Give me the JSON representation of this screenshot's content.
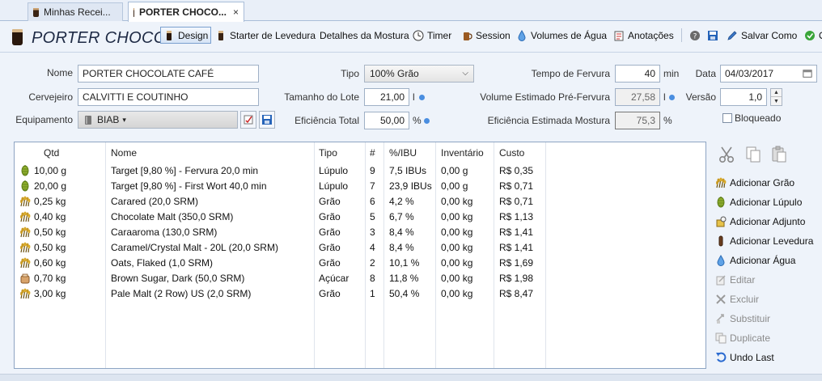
{
  "tabs": [
    {
      "label": "Minhas Recei...",
      "active": false
    },
    {
      "label": "PORTER CHOCO...",
      "active": true,
      "close": "×"
    }
  ],
  "recipe_title": "PORTER CHOCO",
  "toolbar": {
    "design": "Design",
    "starter": "Starter de Levedura",
    "detalhes": "Detalhes da Mostura",
    "timer": "Timer",
    "session": "Session",
    "volumes": "Volumes de Água",
    "anotacoes": "Anotações",
    "salvar_como": "Salvar Como",
    "ok_partial": "O"
  },
  "form": {
    "nome_label": "Nome",
    "nome": "PORTER CHOCOLATE CAFÉ",
    "cervejeiro_label": "Cervejeiro",
    "cervejeiro": "CALVITTI E COUTINHO",
    "equipamento_label": "Equipamento",
    "equipamento": "BIAB",
    "tipo_label": "Tipo",
    "tipo": "100% Grão",
    "tamanho_label": "Tamanho do Lote",
    "tamanho": "21,00",
    "tamanho_unit": "l",
    "eficiencia_label": "Eficiência Total",
    "eficiencia": "50,00",
    "eficiencia_unit": "%",
    "tempo_label": "Tempo de Fervura",
    "tempo": "40",
    "tempo_unit": "min",
    "vol_label": "Volume Estimado Pré-Fervura",
    "vol": "27,58",
    "vol_unit": "l",
    "efm_label": "Eficiência Estimada Mostura",
    "efm": "75,3",
    "efm_unit": "%",
    "data_label": "Data",
    "data": "04/03/2017",
    "versao_label": "Versão",
    "versao": "1,0",
    "bloqueado_label": "Bloqueado"
  },
  "table": {
    "headers": [
      "Qtd",
      "Nome",
      "Tipo",
      "#",
      "%/IBU",
      "Inventário",
      "Custo"
    ],
    "rows": [
      {
        "icon": "hop-icon",
        "qtd": "10,00 g",
        "nome": "Target [9,80 %] - Fervura 20,0 min",
        "tipo": "Lúpulo",
        "n": "9",
        "pct": "7,5 IBUs",
        "inv": "0,00 g",
        "custo": "R$ 0,35"
      },
      {
        "icon": "hop-icon",
        "qtd": "20,00 g",
        "nome": "Target [9,80 %] - First Wort 40,0 min",
        "tipo": "Lúpulo",
        "n": "7",
        "pct": "23,9 IBUs",
        "inv": "0,00 g",
        "custo": "R$ 0,71"
      },
      {
        "icon": "grain-icon",
        "qtd": "0,25 kg",
        "nome": "Carared (20,0 SRM)",
        "tipo": "Grão",
        "n": "6",
        "pct": "4,2 %",
        "inv": "0,00 kg",
        "custo": "R$ 0,71"
      },
      {
        "icon": "grain-icon",
        "qtd": "0,40 kg",
        "nome": "Chocolate Malt (350,0 SRM)",
        "tipo": "Grão",
        "n": "5",
        "pct": "6,7 %",
        "inv": "0,00 kg",
        "custo": "R$ 1,13"
      },
      {
        "icon": "grain-icon",
        "qtd": "0,50 kg",
        "nome": "Caraaroma (130,0 SRM)",
        "tipo": "Grão",
        "n": "3",
        "pct": "8,4 %",
        "inv": "0,00 kg",
        "custo": "R$ 1,41"
      },
      {
        "icon": "grain-icon",
        "qtd": "0,50 kg",
        "nome": "Caramel/Crystal Malt - 20L (20,0 SRM)",
        "tipo": "Grão",
        "n": "4",
        "pct": "8,4 %",
        "inv": "0,00 kg",
        "custo": "R$ 1,41"
      },
      {
        "icon": "grain-icon",
        "qtd": "0,60 kg",
        "nome": "Oats, Flaked (1,0 SRM)",
        "tipo": "Grão",
        "n": "2",
        "pct": "10,1 %",
        "inv": "0,00 kg",
        "custo": "R$ 1,69"
      },
      {
        "icon": "sugar-icon",
        "qtd": "0,70 kg",
        "nome": "Brown Sugar, Dark (50,0 SRM)",
        "tipo": "Açúcar",
        "n": "8",
        "pct": "11,8 %",
        "inv": "0,00 kg",
        "custo": "R$ 1,98"
      },
      {
        "icon": "grain-icon",
        "qtd": "3,00 kg",
        "nome": "Pale Malt (2 Row) US (2,0 SRM)",
        "tipo": "Grão",
        "n": "1",
        "pct": "50,4 %",
        "inv": "0,00 kg",
        "custo": "R$ 8,47"
      }
    ]
  },
  "side": {
    "adicionar_grao": "Adicionar Grão",
    "adicionar_lupulo": "Adicionar Lúpulo",
    "adicionar_adjunto": "Adicionar Adjunto",
    "adicionar_levedura": "Adicionar Levedura",
    "adicionar_agua": "Adicionar Água",
    "editar": "Editar",
    "excluir": "Excluir",
    "substituir": "Substituir",
    "duplicate": "Duplicate",
    "undo": "Undo Last"
  },
  "colors": {
    "accent": "#4a8ee0",
    "selection_border": "#7aa0cf",
    "background": "#eef3fa"
  }
}
